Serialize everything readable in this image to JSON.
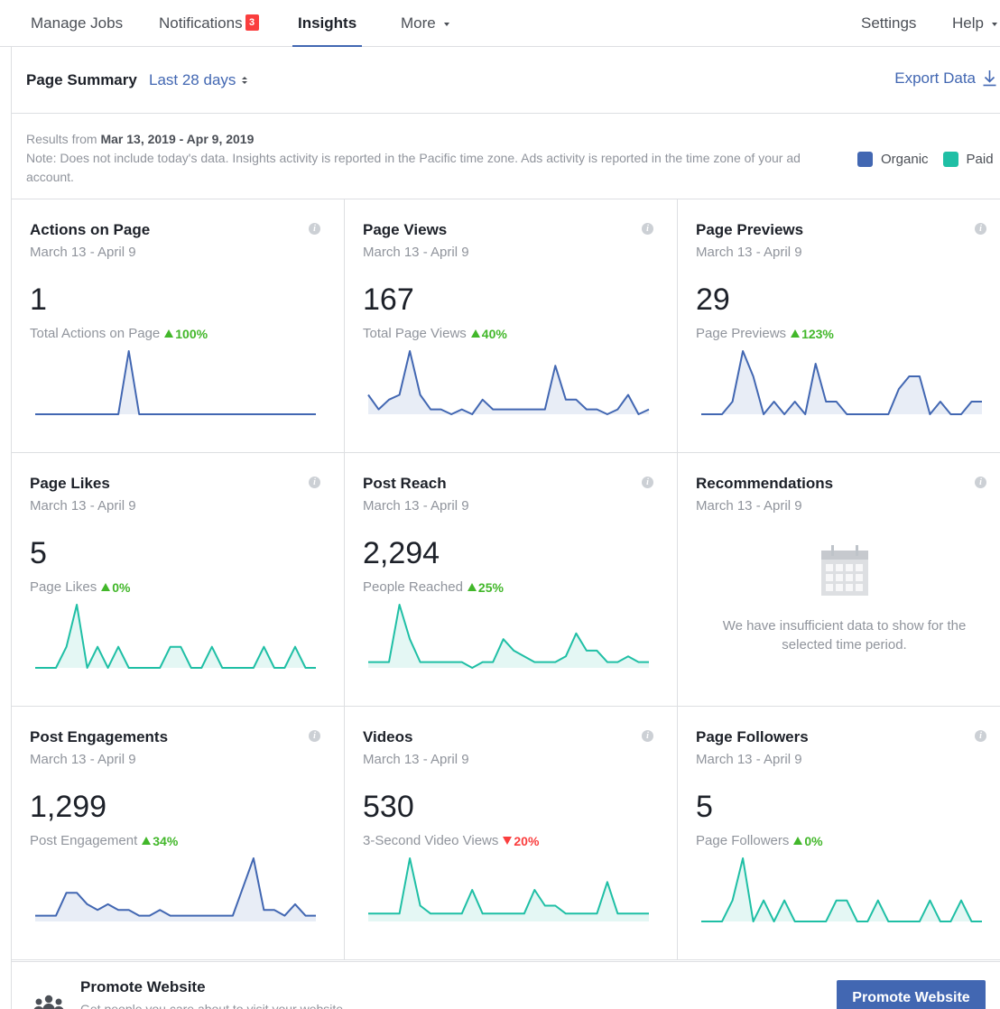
{
  "nav": {
    "manage_jobs": "Manage Jobs",
    "notifications": "Notifications",
    "notifications_count": "3",
    "insights": "Insights",
    "more": "More",
    "settings": "Settings",
    "help": "Help"
  },
  "summary": {
    "title": "Page Summary",
    "range": "Last 28 days",
    "export": "Export Data"
  },
  "results": {
    "prefix": "Results from",
    "range": "Mar 13, 2019 - Apr 9, 2019",
    "note": "Note: Does not include today's data. Insights activity is reported in the Pacific time zone. Ads activity is reported in the time zone of your ad account."
  },
  "legend": {
    "organic": "Organic",
    "paid": "Paid",
    "organic_color": "#4267b2",
    "paid_color": "#1fbfa5"
  },
  "colors": {
    "accent": "#4267b2",
    "up": "#42b72a",
    "down": "#fa3e3e"
  },
  "cards": [
    {
      "title": "Actions on Page",
      "date": "March 13 - April 9",
      "value": "1",
      "sub": "Total Actions on Page",
      "delta": "100%",
      "direction": "up",
      "series": "organic",
      "spark": [
        0,
        0,
        0,
        0,
        0,
        0,
        0,
        0,
        0,
        1,
        0,
        0,
        0,
        0,
        0,
        0,
        0,
        0,
        0,
        0,
        0,
        0,
        0,
        0,
        0,
        0,
        0,
        0
      ]
    },
    {
      "title": "Page Views",
      "date": "March 13 - April 9",
      "value": "167",
      "sub": "Total Page Views",
      "delta": "40%",
      "direction": "up",
      "series": "organic",
      "spark": [
        4,
        1,
        3,
        4,
        13,
        4,
        1,
        1,
        0,
        1,
        0,
        3,
        1,
        1,
        1,
        1,
        1,
        1,
        10,
        3,
        3,
        1,
        1,
        0,
        1,
        4,
        0,
        1
      ]
    },
    {
      "title": "Page Previews",
      "date": "March 13 - April 9",
      "value": "29",
      "sub": "Page Previews",
      "delta": "123%",
      "direction": "up",
      "series": "organic",
      "spark": [
        0,
        0,
        0,
        1,
        5,
        3,
        0,
        1,
        0,
        1,
        0,
        4,
        1,
        1,
        0,
        0,
        0,
        0,
        0,
        2,
        3,
        3,
        0,
        1,
        0,
        0,
        1,
        1
      ]
    },
    {
      "title": "Page Likes",
      "date": "March 13 - April 9",
      "value": "5",
      "sub": "Page Likes",
      "delta": "0%",
      "direction": "up",
      "series": "paid",
      "spark": [
        0,
        0,
        0,
        1,
        3,
        0,
        1,
        0,
        1,
        0,
        0,
        0,
        0,
        1,
        1,
        0,
        0,
        1,
        0,
        0,
        0,
        0,
        1,
        0,
        0,
        1,
        0,
        0
      ]
    },
    {
      "title": "Post Reach",
      "date": "March 13 - April 9",
      "value": "2,294",
      "sub": "People Reached",
      "delta": "25%",
      "direction": "up",
      "series": "paid",
      "spark": [
        1,
        1,
        1,
        11,
        5,
        1,
        1,
        1,
        1,
        1,
        0,
        1,
        1,
        5,
        3,
        2,
        1,
        1,
        1,
        2,
        6,
        3,
        3,
        1,
        1,
        2,
        1,
        1
      ]
    },
    {
      "title": "Recommendations",
      "date": "March 13 - April 9",
      "nodata": "We have insufficient data to show for the selected time period."
    },
    {
      "title": "Post Engagements",
      "date": "March 13 - April 9",
      "value": "1,299",
      "sub": "Post Engagement",
      "delta": "34%",
      "direction": "up",
      "series": "organic",
      "spark": [
        1,
        1,
        1,
        5,
        5,
        3,
        2,
        3,
        2,
        2,
        1,
        1,
        2,
        1,
        1,
        1,
        1,
        1,
        1,
        1,
        6,
        11,
        2,
        2,
        1,
        3,
        1,
        1
      ]
    },
    {
      "title": "Videos",
      "date": "March 13 - April 9",
      "value": "530",
      "sub": "3-Second Video Views",
      "delta": "20%",
      "direction": "down",
      "series": "paid",
      "spark": [
        1,
        1,
        1,
        1,
        8,
        2,
        1,
        1,
        1,
        1,
        4,
        1,
        1,
        1,
        1,
        1,
        4,
        2,
        2,
        1,
        1,
        1,
        1,
        5,
        1,
        1,
        1,
        1
      ]
    },
    {
      "title": "Page Followers",
      "date": "March 13 - April 9",
      "value": "5",
      "sub": "Page Followers",
      "delta": "0%",
      "direction": "up",
      "series": "paid",
      "spark": [
        0,
        0,
        0,
        1,
        3,
        0,
        1,
        0,
        1,
        0,
        0,
        0,
        0,
        1,
        1,
        0,
        0,
        1,
        0,
        0,
        0,
        0,
        1,
        0,
        0,
        1,
        0,
        0
      ]
    }
  ],
  "promote": {
    "title": "Promote Website",
    "sub": "Get people you care about to visit your website.",
    "button": "Promote Website"
  }
}
